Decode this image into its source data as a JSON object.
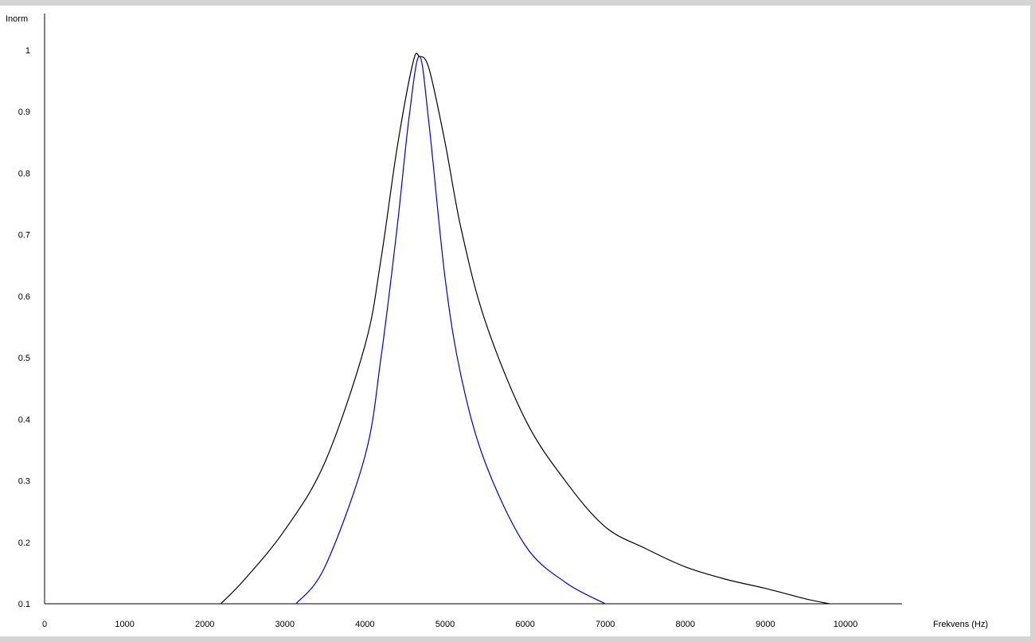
{
  "chart_data": {
    "type": "line",
    "title": "",
    "xlabel": "Frekvens (Hz)",
    "ylabel": "Inorm",
    "xlim": [
      0,
      10800
    ],
    "ylim": [
      0.1,
      1.0
    ],
    "xticks": [
      0,
      1000,
      2000,
      3000,
      4000,
      5000,
      6000,
      7000,
      8000,
      9000,
      10000
    ],
    "yticks": [
      0.1,
      0.2,
      0.3,
      0.4,
      0.5,
      0.6,
      0.7,
      0.8,
      0.9,
      1
    ],
    "grid": false,
    "series": [
      {
        "color": "#000000",
        "x": [
          2200,
          2500,
          3000,
          3500,
          4000,
          4200,
          4400,
          4600,
          4680,
          4800,
          5000,
          5200,
          5500,
          6000,
          6500,
          7000,
          7500,
          8000,
          8500,
          9000,
          9500,
          9800
        ],
        "y": [
          0.1,
          0.14,
          0.22,
          0.33,
          0.52,
          0.66,
          0.84,
          0.98,
          0.99,
          0.97,
          0.85,
          0.71,
          0.56,
          0.4,
          0.3,
          0.225,
          0.19,
          0.16,
          0.14,
          0.125,
          0.108,
          0.1
        ]
      },
      {
        "color": "#0000cc",
        "x": [
          3140,
          3500,
          4000,
          4200,
          4400,
          4550,
          4680,
          4800,
          5000,
          5200,
          5500,
          6000,
          6500,
          7000
        ],
        "y": [
          0.1,
          0.16,
          0.34,
          0.5,
          0.71,
          0.89,
          0.99,
          0.88,
          0.63,
          0.47,
          0.33,
          0.195,
          0.135,
          0.1
        ]
      }
    ]
  }
}
